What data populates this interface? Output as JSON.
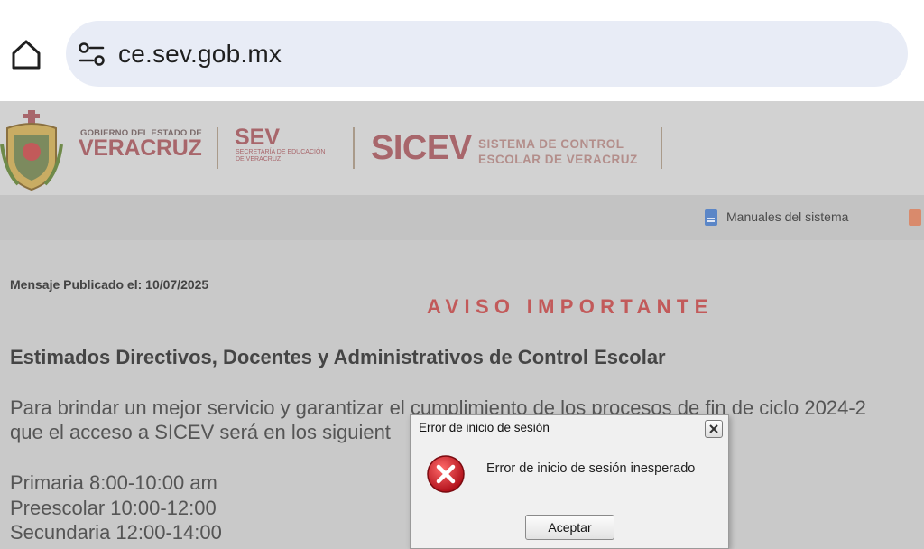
{
  "browser": {
    "home_icon": "home-icon",
    "settings_icon": "page-settings-icon",
    "url": "ce.sev.gob.mx"
  },
  "header": {
    "gob_line": "GOBIERNO DEL ESTADO DE",
    "state": "VERACRUZ",
    "sev": "SEV",
    "sev_sub_1": "SECRETARÍA DE EDUCACIÓN",
    "sev_sub_2": "DE VERACRUZ",
    "sicev": "SICEV",
    "sicev_sub_1": "SISTEMA DE CONTROL",
    "sicev_sub_2": "ESCOLAR DE VERACRUZ",
    "brand_color": "#a8666b"
  },
  "nav": {
    "manuales_label": "Manuales del sistema"
  },
  "content": {
    "mensaje": "Mensaje Publicado el: 10/07/2025",
    "aviso": "AVISO IMPORTANTE",
    "estimados": "Estimados Directivos, Docentes y Administrativos de Control Escolar",
    "para_line1": "Para brindar un mejor servicio y garantizar el cumplimiento de los procesos de fin de ciclo 2024-2",
    "para_line2": "que el acceso a SICEV será en los siguient",
    "schedule": [
      "Primaria 8:00-10:00 am",
      "Preescolar 10:00-12:00",
      "Secundaria  12:00-14:00"
    ]
  },
  "dialog": {
    "title": "Error de inicio de sesión",
    "message": "Error de inicio de sesión inesperado",
    "accept_label": "Aceptar",
    "error_color": "#d0202a"
  }
}
